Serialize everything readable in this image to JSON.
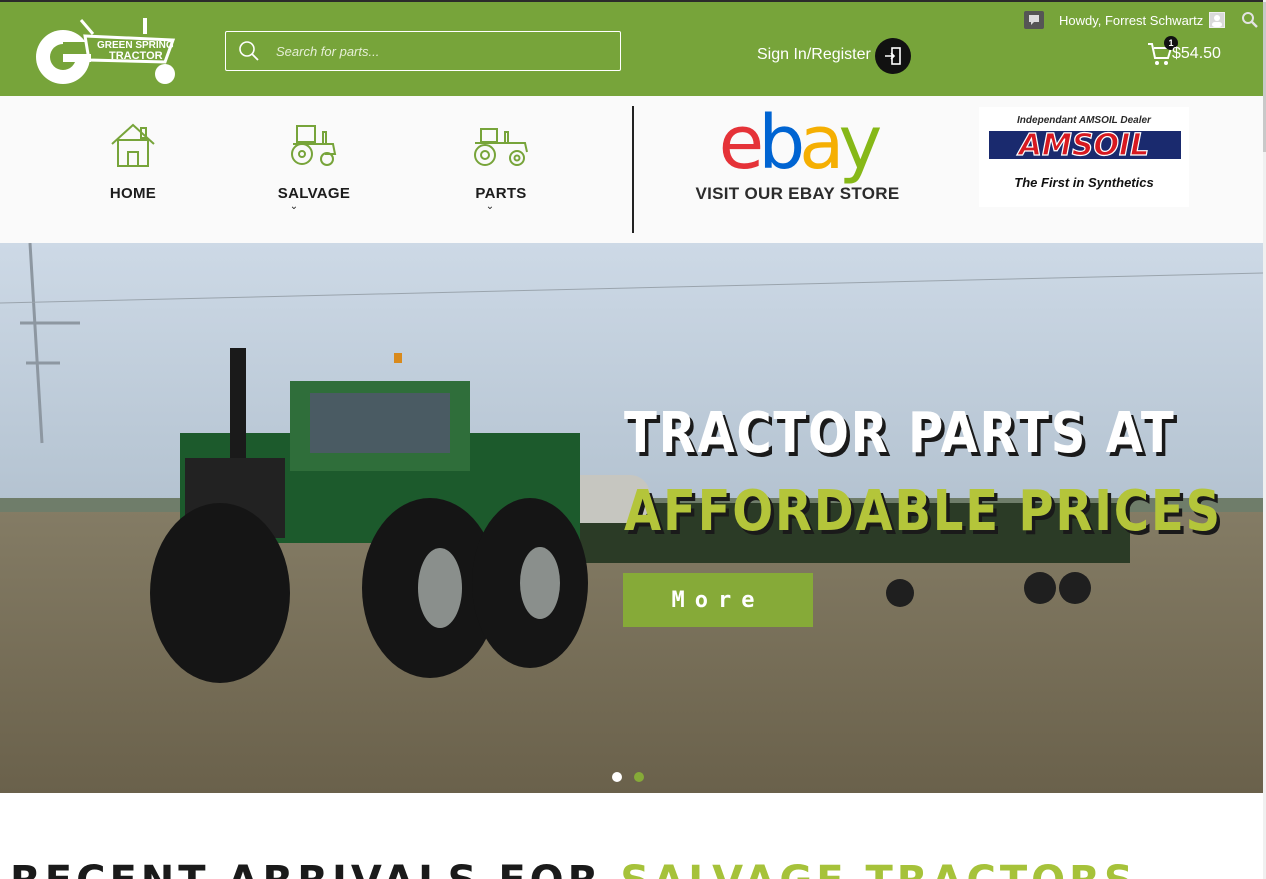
{
  "brand": {
    "logo_lines": [
      "GREEN SPRING",
      "TRACTOR"
    ],
    "accent": "#77a43a"
  },
  "search": {
    "placeholder": "Search for parts..."
  },
  "account": {
    "signin_label": "Sign In/Register",
    "greeting": "Howdy, Forrest Schwartz"
  },
  "cart": {
    "count": "1",
    "total": "$54.50"
  },
  "nav": {
    "items": [
      {
        "label": "HOME",
        "icon": "house-icon",
        "has_dropdown": false
      },
      {
        "label": "SALVAGE",
        "icon": "tractor-icon",
        "has_dropdown": true
      },
      {
        "label": "PARTS",
        "icon": "tractor-parts-icon",
        "has_dropdown": true
      }
    ],
    "ebay": {
      "logo_letters": [
        "e",
        "b",
        "a",
        "y"
      ],
      "colors": [
        "#e53238",
        "#0064d2",
        "#f5af02",
        "#86b817"
      ],
      "cta": "VISIT OUR EBAY STORE"
    },
    "amsoil": {
      "top": "Independant AMSOIL Dealer",
      "name": "AMSOIL",
      "tagline": "The First in Synthetics"
    }
  },
  "hero": {
    "headline_1": "TRACTOR PARTS AT",
    "headline_2": "AFFORDABLE PRICES",
    "button_label": "More",
    "slides": 2,
    "active_slide": 1
  },
  "section": {
    "title_dark": "RECENT ARRIVALS FOR",
    "title_highlight": "SALVAGE TRACTORS"
  }
}
